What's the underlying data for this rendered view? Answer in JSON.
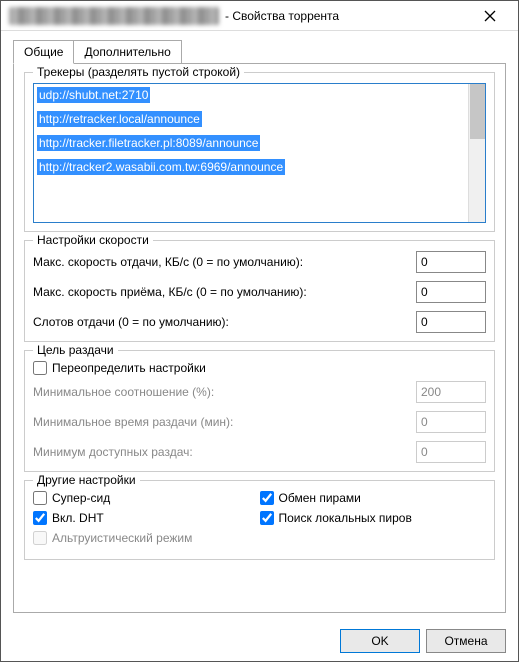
{
  "titlebar": {
    "suffix": "- Свойства торрента"
  },
  "tabs": {
    "general": "Общие",
    "advanced": "Дополнительно"
  },
  "trackers": {
    "title": "Трекеры (разделять пустой строкой)",
    "list": [
      "udp://shubt.net:2710",
      "http://retracker.local/announce",
      "http://tracker.filetracker.pl:8089/announce",
      "http://tracker2.wasabii.com.tw:6969/announce"
    ]
  },
  "speed": {
    "title": "Настройки скорости",
    "upload_label": "Макс. скорость отдачи, КБ/с (0 = по умолчанию):",
    "upload_value": "0",
    "download_label": "Макс. скорость приёма, КБ/с (0 = по умолчанию):",
    "download_value": "0",
    "slots_label": "Слотов отдачи (0 = по умолчанию):",
    "slots_value": "0"
  },
  "seeding": {
    "title": "Цель раздачи",
    "override_label": "Переопределить настройки",
    "ratio_label": "Минимальное соотношение (%):",
    "ratio_value": "200",
    "time_label": "Минимальное время раздачи (мин):",
    "time_value": "0",
    "avail_label": "Минимум доступных раздач:",
    "avail_value": "0"
  },
  "other": {
    "title": "Другие настройки",
    "superseed_label": "Супер-сид",
    "dht_label": "Вкл. DHT",
    "altruistic_label": "Альтруистический режим",
    "pex_label": "Обмен пирами",
    "lsd_label": "Поиск локальных пиров"
  },
  "buttons": {
    "ok": "OK",
    "cancel": "Отмена"
  }
}
